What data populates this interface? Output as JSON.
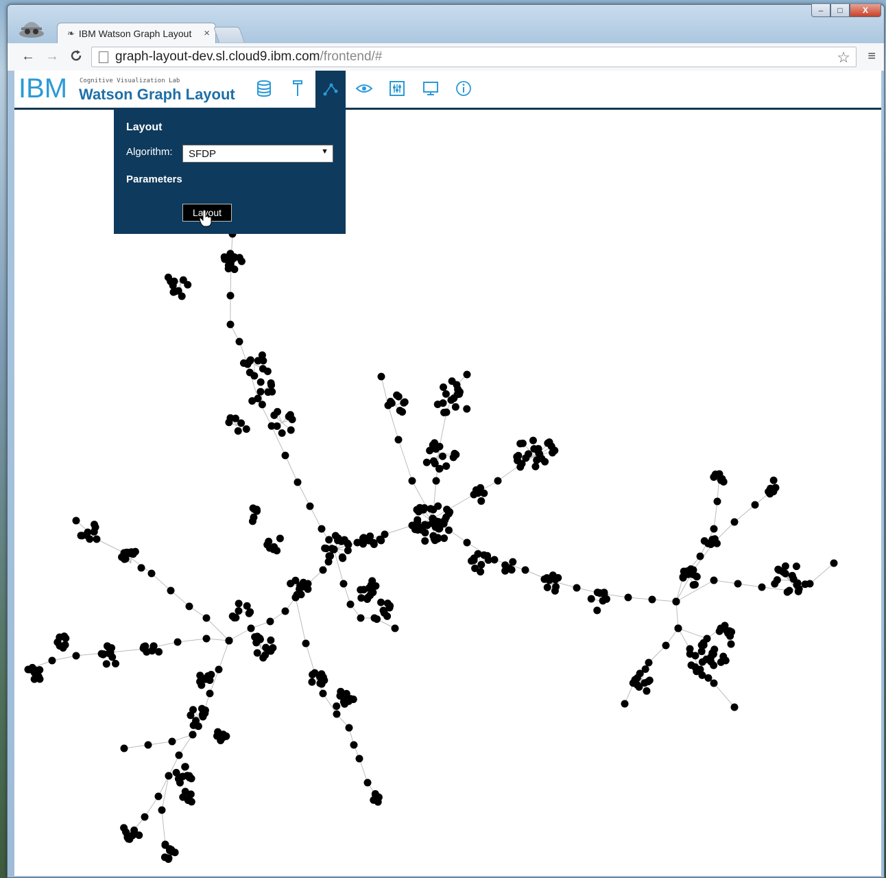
{
  "browser": {
    "tab_title": "IBM Watson Graph Layout",
    "tab_close": "×",
    "url_host": "graph-layout-dev.sl.cloud9.ibm.com",
    "url_path": "/frontend/#",
    "back": "←",
    "forward": "→",
    "reload": "C",
    "star": "☆",
    "menu": "≡",
    "win_min": "–",
    "win_max": "□",
    "win_close": "X"
  },
  "app": {
    "logo": "IBM",
    "lab": "Cognitive Visualization Lab",
    "title": "Watson Graph Layout",
    "toolbar_icons": [
      "database-icon",
      "pin-icon",
      "layout-icon",
      "eye-icon",
      "sliders-icon",
      "monitor-icon",
      "info-icon"
    ],
    "accent": "#2b9ad6",
    "panel_color": "#0e3a5d"
  },
  "layout_panel": {
    "heading": "Layout",
    "algorithm_label": "Algorithm:",
    "algorithm_value": "SFDP",
    "parameters_heading": "Parameters",
    "button_label": "Layout"
  },
  "graph": {
    "node_color": "#000000",
    "edge_color": "#bbbbbb"
  }
}
